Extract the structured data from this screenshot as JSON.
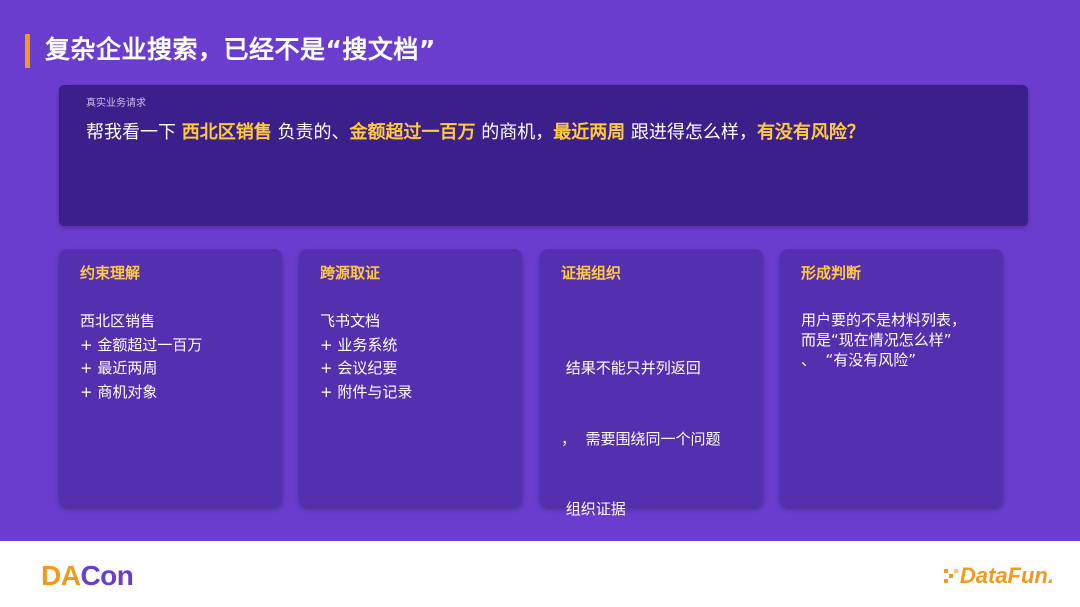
{
  "slide": {
    "title": "复杂企业搜索，已经不是“搜文档”"
  },
  "request": {
    "label": "真实业务请求",
    "segments": [
      {
        "text": "帮我看一下 ",
        "highlight": false
      },
      {
        "text": "西北区销售",
        "highlight": true
      },
      {
        "text": " 负责的、",
        "highlight": false
      },
      {
        "text": "金额超过一百万",
        "highlight": true
      },
      {
        "text": " 的商机，",
        "highlight": false
      },
      {
        "text": "最近两周",
        "highlight": true
      },
      {
        "text": " 跟进得怎么样，",
        "highlight": false
      },
      {
        "text": "有没有风险？",
        "highlight": true
      }
    ]
  },
  "cards": [
    {
      "title": "约束理解",
      "lines": [
        "西北区销售",
        "+ 金额超过一百万",
        "+ 最近两周",
        "+ 商机对象"
      ]
    },
    {
      "title": "跨源取证",
      "lines": [
        "飞书文档",
        "+ 业务系统",
        "+ 会议纪要",
        "+ 附件与记录"
      ]
    },
    {
      "title": "证据组织",
      "lines": [
        " 结果不能只并列返回",
        "，  需要围绕同一个问题",
        " 组织证据"
      ]
    },
    {
      "title": "形成判断",
      "lines": [
        "用户要的不是材料列表，",
        "而是“现在情况怎么样”",
        "、  “有没有风险”"
      ]
    }
  ],
  "footer": {
    "left_logo_da": "DA",
    "left_logo_con": "Con",
    "right_logo": "DataFun."
  },
  "colors": {
    "background": "#6a3dcf",
    "request_box": "#3b208c",
    "card": "#5430b0",
    "highlight": "#ffc93c",
    "accent": "#f39a1e"
  }
}
